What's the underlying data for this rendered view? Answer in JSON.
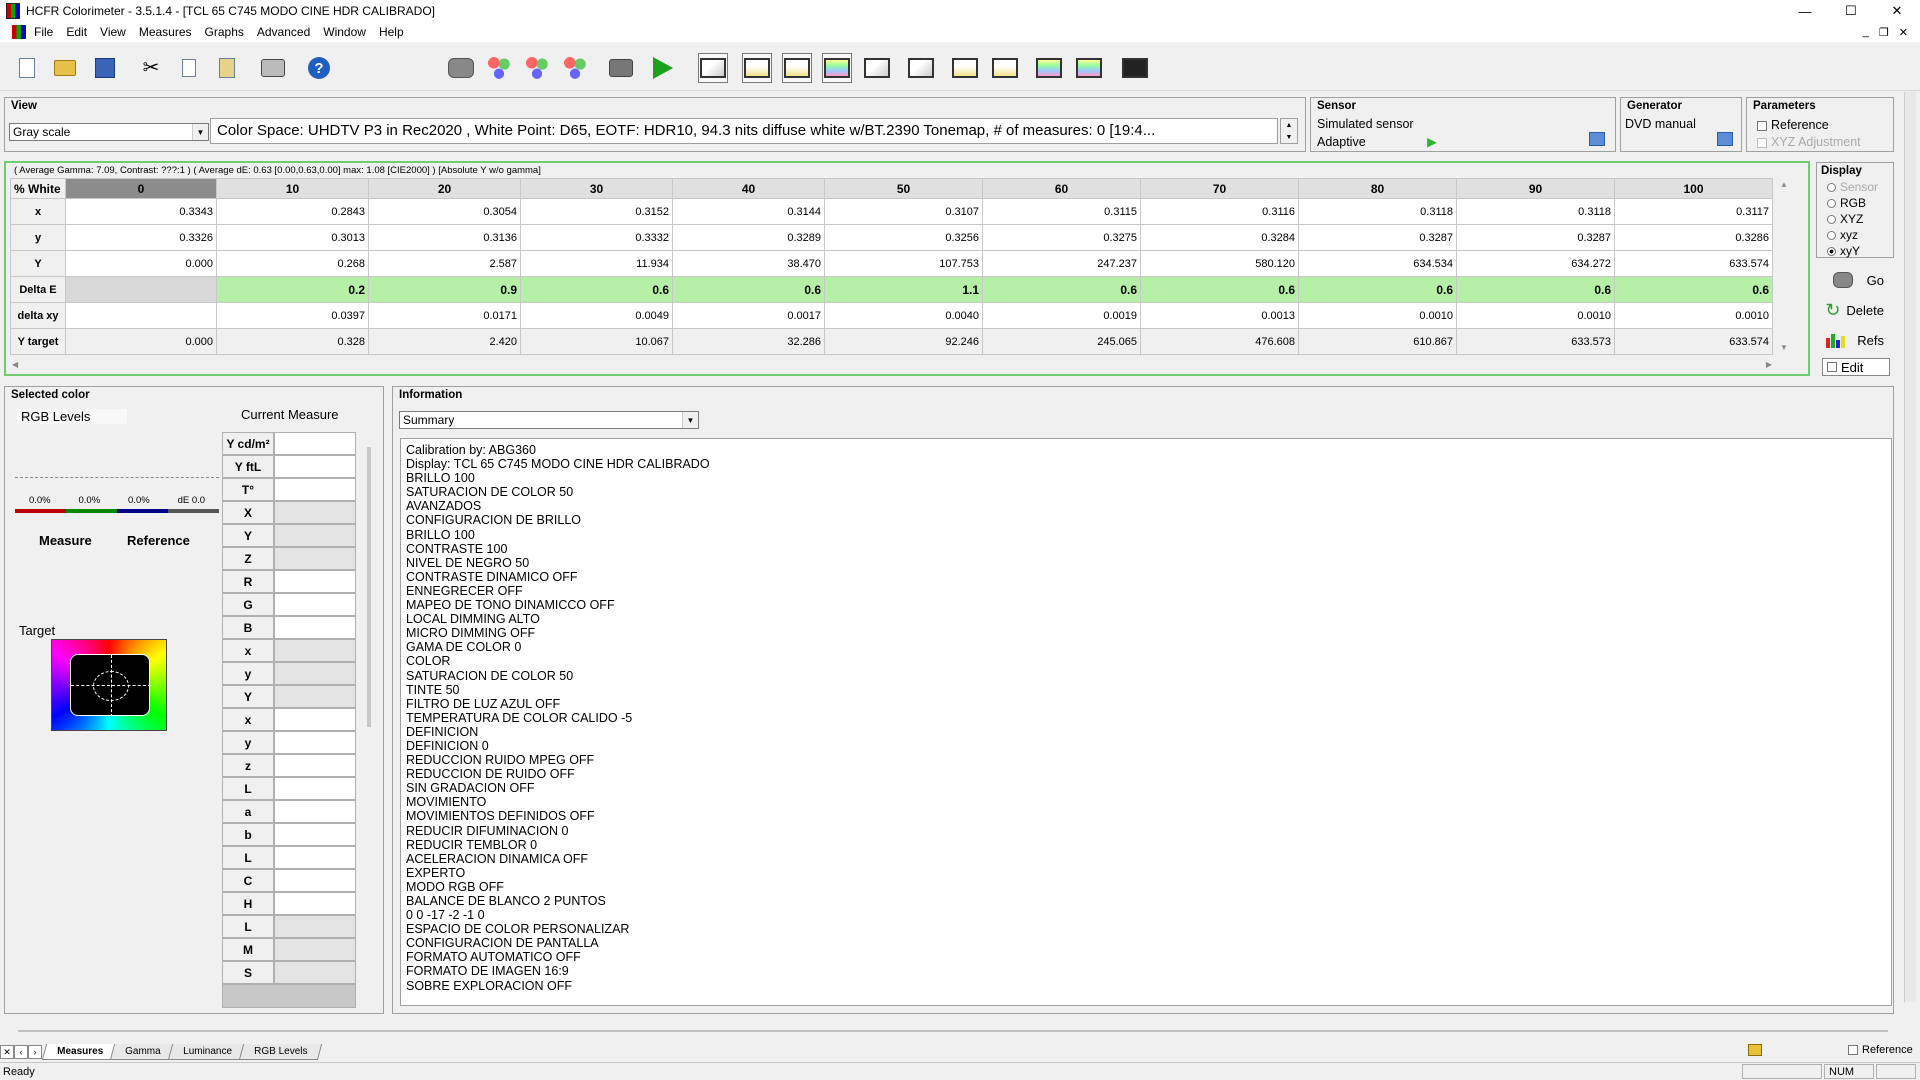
{
  "window": {
    "title": "HCFR Colorimeter - 3.5.1.4 - [TCL 65 C745 MODO CINE HDR CALIBRADO]",
    "controls": [
      "—",
      "☐",
      "✕"
    ],
    "mdi_controls": [
      "_",
      "❐",
      "✕"
    ]
  },
  "menu": [
    "File",
    "Edit",
    "View",
    "Measures",
    "Graphs",
    "Advanced",
    "Window",
    "Help"
  ],
  "view_panel": {
    "title": "View",
    "selected": "Gray scale",
    "color_space_info": "Color Space: UHDTV P3 in Rec2020 , White Point: D65, EOTF:  HDR10, 94.3 nits diffuse white w/BT.2390 Tonemap, # of measures: 0 [19:4..."
  },
  "sensor_panel": {
    "title": "Sensor",
    "name": "Simulated sensor",
    "mode": "Adaptive"
  },
  "generator_panel": {
    "title": "Generator",
    "name": "DVD manual"
  },
  "parameters_panel": {
    "title": "Parameters",
    "reference": "Reference",
    "xyz_adjustment": "XYZ Adjustment"
  },
  "summary_line": "( Average Gamma: 7.09, Contrast: ???:1 ) ( Average dE: 0.63 [0.00,0.63,0.00] max: 1.08 [CIE2000] ) [Absolute Y w/o gamma]",
  "grid": {
    "corner": "% White",
    "columns": [
      "0",
      "10",
      "20",
      "30",
      "40",
      "50",
      "60",
      "70",
      "80",
      "90",
      "100"
    ],
    "rows": [
      {
        "label": "x",
        "values": [
          "0.3343",
          "0.2843",
          "0.3054",
          "0.3152",
          "0.3144",
          "0.3107",
          "0.3115",
          "0.3116",
          "0.3118",
          "0.3118",
          "0.3117"
        ]
      },
      {
        "label": "y",
        "values": [
          "0.3326",
          "0.3013",
          "0.3136",
          "0.3332",
          "0.3289",
          "0.3256",
          "0.3275",
          "0.3284",
          "0.3287",
          "0.3287",
          "0.3286"
        ]
      },
      {
        "label": "Y",
        "values": [
          "0.000",
          "0.268",
          "2.587",
          "11.934",
          "38.470",
          "107.753",
          "247.237",
          "580.120",
          "634.534",
          "634.272",
          "633.574"
        ]
      },
      {
        "label": "Delta E",
        "values": [
          "",
          "0.2",
          "0.9",
          "0.6",
          "0.6",
          "1.1",
          "0.6",
          "0.6",
          "0.6",
          "0.6",
          "0.6"
        ]
      },
      {
        "label": "delta xy",
        "values": [
          "",
          "0.0397",
          "0.0171",
          "0.0049",
          "0.0017",
          "0.0040",
          "0.0019",
          "0.0013",
          "0.0010",
          "0.0010",
          "0.0010"
        ]
      },
      {
        "label": "Y target",
        "values": [
          "0.000",
          "0.328",
          "2.420",
          "10.067",
          "32.286",
          "92.246",
          "245.065",
          "476.608",
          "610.867",
          "633.573",
          "633.574"
        ]
      }
    ]
  },
  "display_panel": {
    "title": "Display",
    "options": [
      {
        "label": "Sensor",
        "selected": false,
        "disabled": true
      },
      {
        "label": "RGB",
        "selected": false,
        "disabled": false
      },
      {
        "label": "XYZ",
        "selected": false,
        "disabled": false
      },
      {
        "label": "xyz",
        "selected": false,
        "disabled": false
      },
      {
        "label": "xyY",
        "selected": true,
        "disabled": false
      }
    ],
    "go": "Go",
    "delete": "Delete",
    "refs": "Refs",
    "edit": "Edit"
  },
  "selected_color": {
    "title": "Selected color",
    "rgb_levels": "RGB Levels",
    "current_measure": "Current Measure",
    "percents": [
      "0.0%",
      "0.0%",
      "0.0%",
      "dE 0.0"
    ],
    "measure": "Measure",
    "reference": "Reference",
    "target": "Target",
    "measure_labels": [
      "Y cd/m²",
      "Y ftL",
      "T°",
      "X",
      "Y",
      "Z",
      "R",
      "G",
      "B",
      "x",
      "y",
      "Y",
      "x",
      "y",
      "z",
      "L",
      "a",
      "b",
      "L",
      "C",
      "H",
      "L",
      "M",
      "S"
    ]
  },
  "information": {
    "title": "Information",
    "selected": "Summary",
    "lines": [
      "Calibration by: ABG360",
      "Display: TCL 65 C745 MODO CINE HDR CALIBRADO",
      "BRILLO 100",
      "SATURACION DE COLOR 50",
      "AVANZADOS",
      "CONFIGURACION DE BRILLO",
      "BRILLO 100",
      "CONTRASTE 100",
      "NIVEL DE NEGRO 50",
      "CONTRASTE DINAMICO OFF",
      "ENNEGRECER OFF",
      "MAPEO DE TONO DINAMICCO OFF",
      "LOCAL DIMMING ALTO",
      "MICRO DIMMING OFF",
      "GAMA DE COLOR 0",
      "COLOR",
      "SATURACION DE COLOR 50",
      "TINTE 50",
      "FILTRO DE LUZ AZUL OFF",
      "TEMPERATURA DE COLOR CALIDO -5",
      "DEFINICION",
      "DEFINICION 0",
      "REDUCCION RUIDO MPEG OFF",
      "REDUCCION DE RUIDO OFF",
      "SIN GRADACION OFF",
      "MOVIMIENTO",
      "MOVIMIENTOS DEFINIDOS OFF",
      "REDUCIR DIFUMINACION 0",
      "REDUCIR TEMBLOR 0",
      "ACELERACION DINAMICA OFF",
      "EXPERTO",
      "MODO RGB OFF",
      "BALANCE DE BLANCO 2 PUNTOS",
      "0 0 -17 -2 -1 0",
      "ESPACIO DE COLOR PERSONALIZAR",
      "CONFIGURACION DE PANTALLA",
      "FORMATO AUTOMATICO OFF",
      "FORMATO DE IMAGEN 16:9",
      "SOBRE EXPLORACION OFF"
    ]
  },
  "tabs": [
    "Measures",
    "Gamma",
    "Luminance",
    "RGB Levels"
  ],
  "tab_nav": [
    "✕",
    "‹",
    "›"
  ],
  "status": {
    "text": "Ready",
    "num": "NUM",
    "reference": "Reference"
  }
}
